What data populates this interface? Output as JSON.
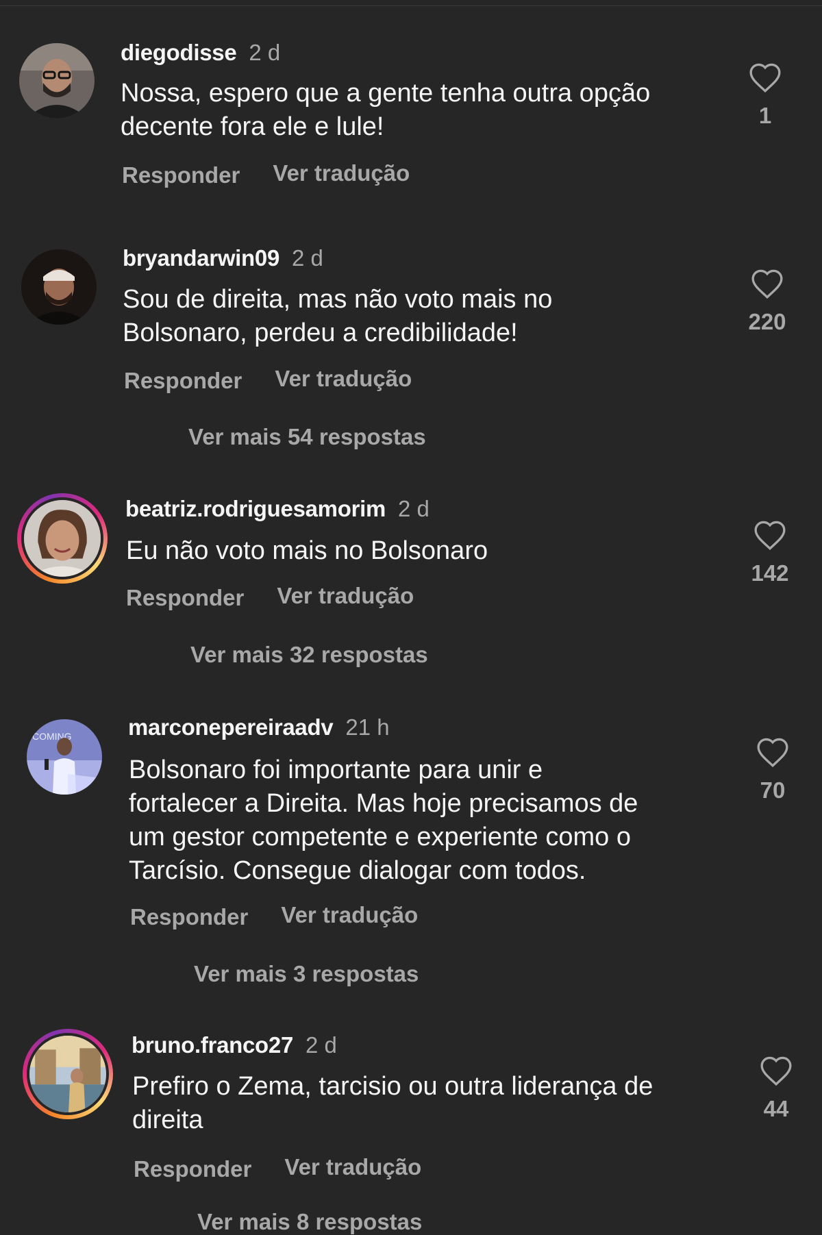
{
  "comments": [
    {
      "username": "diegodisse",
      "time": "2 d",
      "lines": [
        "Nossa, espero que a gente tenha outra opção",
        "decente fora ele e lule!"
      ],
      "likes": "1",
      "reply_label": "Responder",
      "translate_label": "Ver tradução"
    },
    {
      "username": "bryandarwin09",
      "time": "2 d",
      "lines": [
        "Sou de direita, mas não voto mais no",
        "Bolsonaro, perdeu a credibilidade!"
      ],
      "likes": "220",
      "reply_label": "Responder",
      "translate_label": "Ver tradução",
      "more_replies": "Ver mais 54 respostas"
    },
    {
      "username": "beatriz.rodriguesamorim",
      "time": "2 d",
      "lines": [
        "Eu não voto mais no Bolsonaro"
      ],
      "likes": "142",
      "reply_label": "Responder",
      "translate_label": "Ver tradução",
      "more_replies": "Ver mais 32 respostas"
    },
    {
      "username": "marconepereiraadv",
      "time": "21 h",
      "lines": [
        "Bolsonaro foi importante para unir e",
        "fortalecer a Direita. Mas hoje precisamos de",
        "um gestor competente e experiente como o",
        "Tarcísio. Consegue dialogar com todos."
      ],
      "likes": "70",
      "reply_label": "Responder",
      "translate_label": "Ver tradução",
      "more_replies": "Ver mais 3 respostas"
    },
    {
      "username": "bruno.franco27",
      "time": "2 d",
      "lines": [
        "Prefiro o Zema, tarcisio ou outra liderança de",
        "direita"
      ],
      "likes": "44",
      "reply_label": "Responder",
      "translate_label": "Ver tradução",
      "more_replies": "Ver mais 8 respostas"
    }
  ],
  "colors": {
    "background": "#262626",
    "primary_text": "#f5f5f5",
    "secondary_text": "#a8a8a8"
  },
  "icons": {
    "like": "heart-outline-icon",
    "avatar": "user-photo"
  }
}
